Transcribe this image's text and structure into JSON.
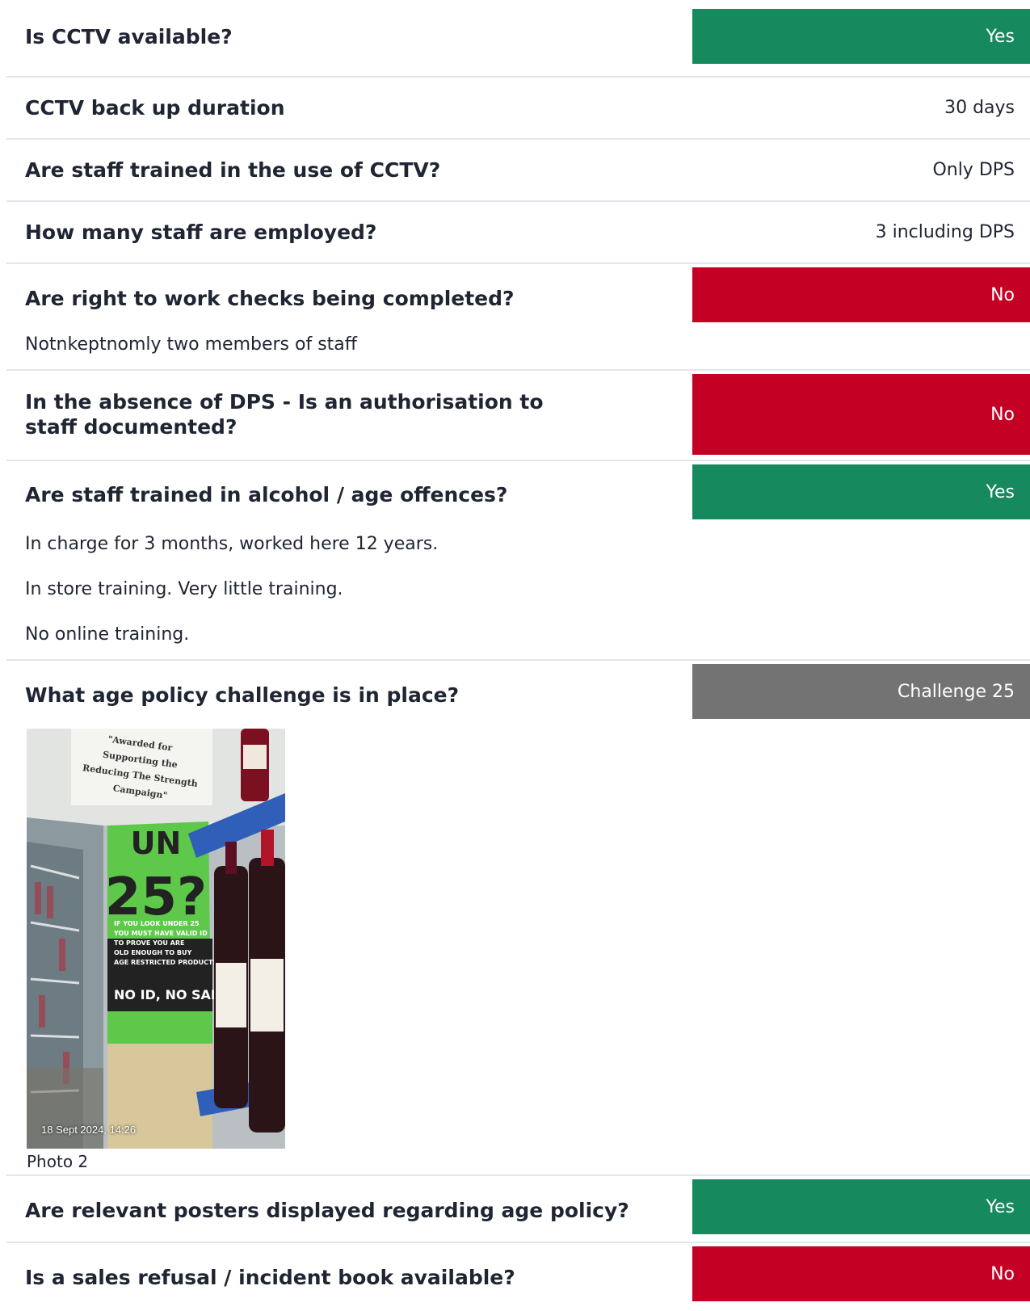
{
  "colors": {
    "yes": "#16895e",
    "no": "#c40024",
    "neutral": "#737373"
  },
  "items": [
    {
      "question": "Is CCTV available?",
      "answer": "Yes",
      "status": "yes"
    },
    {
      "question": "CCTV back up duration",
      "answer": "30 days",
      "status": "plain"
    },
    {
      "question": "Are staff trained in the use of CCTV?",
      "answer": "Only DPS",
      "status": "plain"
    },
    {
      "question": "How many staff are employed?",
      "answer": "3 including DPS",
      "status": "plain"
    },
    {
      "question": "Are right to work checks being completed?",
      "answer": "No",
      "status": "no",
      "notes": [
        "Notnkeptnomly two members of staff"
      ]
    },
    {
      "question": "In the absence of DPS - Is an authorisation to staff documented?",
      "answer": "No",
      "status": "no"
    },
    {
      "question": "Are staff trained in alcohol / age offences?",
      "answer": "Yes",
      "status": "yes",
      "notes": [
        "In charge for 3 months, worked here 12 years.",
        "In store training. Very little training.",
        "No online training."
      ]
    },
    {
      "question": "What age policy challenge is in place?",
      "answer": "Challenge 25",
      "status": "neutral",
      "photo": {
        "caption": "Photo 2",
        "timestamp": "18 Sept 2024, 14:26",
        "sticker_text": "\"Awarded for Supporting the Reducing The Strength Campaign\"",
        "poster_headline": "UNDER 25?",
        "poster_body": "IF YOU LOOK UNDER 25 YOU MUST HAVE VALID ID TO PROVE YOU ARE OLD ENOUGH TO BUY AGE RESTRICTED PRODUCTS",
        "poster_footer": "NO ID, NO SALE"
      }
    },
    {
      "question": "Are relevant posters displayed regarding age policy?",
      "answer": "Yes",
      "status": "yes"
    },
    {
      "question": "Is a sales refusal / incident book available?",
      "answer": "No",
      "status": "no"
    }
  ]
}
